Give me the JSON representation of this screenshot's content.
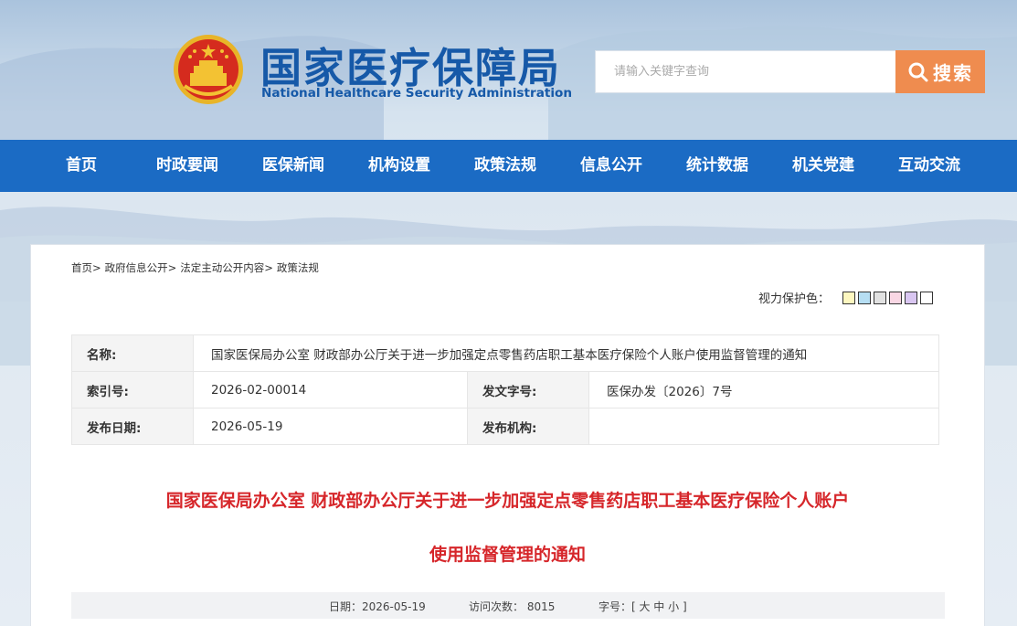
{
  "header": {
    "title": "国家医疗保障局",
    "subtitle": "National Healthcare Security Administration",
    "search_placeholder": "请输入关键字查询",
    "search_button": "搜索"
  },
  "nav": {
    "items": [
      "首页",
      "时政要闻",
      "医保新闻",
      "机构设置",
      "政策法规",
      "信息公开",
      "统计数据",
      "机关党建",
      "互动交流"
    ]
  },
  "breadcrumb": [
    "首页>",
    "政府信息公开>",
    "法定主动公开内容>",
    "政策法规"
  ],
  "eye_protection": {
    "label": "视力保护色：",
    "swatches": [
      "#fdf7c0",
      "#b6def3",
      "#e1e1e1",
      "#f9d7e4",
      "#d9c6f1",
      "#ffffff"
    ]
  },
  "info": {
    "name_label": "名称:",
    "name_value": "国家医保局办公室 财政部办公厅关于进一步加强定点零售药店职工基本医疗保险个人账户使用监督管理的通知",
    "index_label": "索引号:",
    "index_value": "2026-02-00014",
    "docno_label": "发文字号:",
    "docno_value": "医保办发〔2026〕7号",
    "date_label": "发布日期:",
    "date_value": "2026-05-19",
    "org_label": "发布机构:",
    "org_value": ""
  },
  "doc": {
    "title_line1": "国家医保局办公室 财政部办公厅关于进一步加强定点零售药店职工基本医疗保险个人账户",
    "title_line2": "使用监督管理的通知"
  },
  "meta": {
    "date": "日期：2026-05-19",
    "visits": "访问次数：  8015",
    "fontsize": "字号：[ 大  中  小 ]"
  },
  "colors": {
    "nav_bg": "#1b6bc4",
    "title_blue": "#1659a8",
    "search_orange": "#ef8c4f",
    "doc_title_red": "#d6262a"
  }
}
